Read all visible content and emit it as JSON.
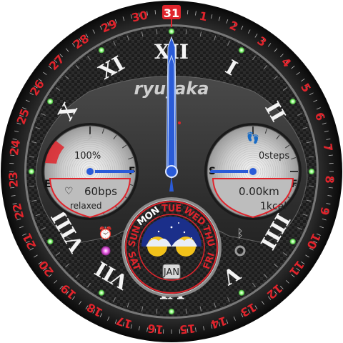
{
  "brand": "ryu_aka",
  "day_numbers": [
    "1",
    "2",
    "3",
    "4",
    "5",
    "6",
    "7",
    "8",
    "9",
    "10",
    "11",
    "12",
    "13",
    "14",
    "15",
    "16",
    "17",
    "18",
    "19",
    "20",
    "21",
    "22",
    "23",
    "24",
    "25",
    "26",
    "27",
    "28",
    "29",
    "30",
    "31"
  ],
  "current_day": "31",
  "roman_numerals": [
    "XII",
    "I",
    "II",
    "III",
    "IIII",
    "V",
    "VI",
    "VII",
    "VIII",
    "IX",
    "X",
    "XI"
  ],
  "battery": {
    "percent_label": "100%",
    "percent": 100,
    "empty_label": "E",
    "full_label": "F"
  },
  "heart": {
    "rate_label": "60bps",
    "state_label": "relaxed"
  },
  "steps": {
    "steps_label": "0steps",
    "start_label": "S",
    "finish_label": "F",
    "distance_label": "0.00km",
    "calories_label": "1kcal"
  },
  "weekdays": [
    "SAT",
    "SUN",
    "MON",
    "TUE",
    "WED",
    "THU",
    "FRI"
  ],
  "current_weekday": "MON",
  "month_label": "JAN",
  "colors": {
    "accent": "#e0242c",
    "hands": "#2a5bd7",
    "bezel": "#141414",
    "marker": "#7dff6a",
    "moon_sky": "#1b2f8a",
    "moon": "#f2c21a",
    "alarm_dot": "#e844e0"
  },
  "icons": {
    "battery": "lightning-icon",
    "heart": "heart-icon",
    "steps": "footprints-icon",
    "alarm": "alarm-clock-icon",
    "bluetooth": "bluetooth-icon",
    "connection": "ring-icon"
  },
  "time": {
    "hour": 12,
    "minute": 0,
    "second": 30
  }
}
